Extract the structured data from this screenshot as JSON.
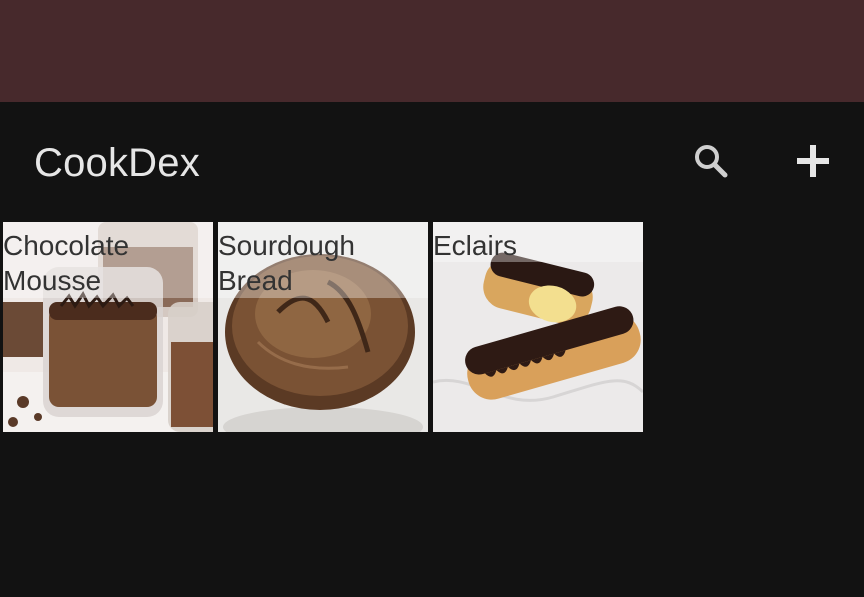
{
  "app": {
    "title": "CookDex"
  },
  "toolbar": {
    "search_icon": "search-icon",
    "add_icon": "plus-icon"
  },
  "colors": {
    "status_bar": "#47292c",
    "background": "#121212",
    "title_text": "#e6e6e6"
  },
  "recipes": [
    {
      "title": "Chocolate Mousse"
    },
    {
      "title": "Sourdough Bread"
    },
    {
      "title": "Eclairs"
    }
  ]
}
